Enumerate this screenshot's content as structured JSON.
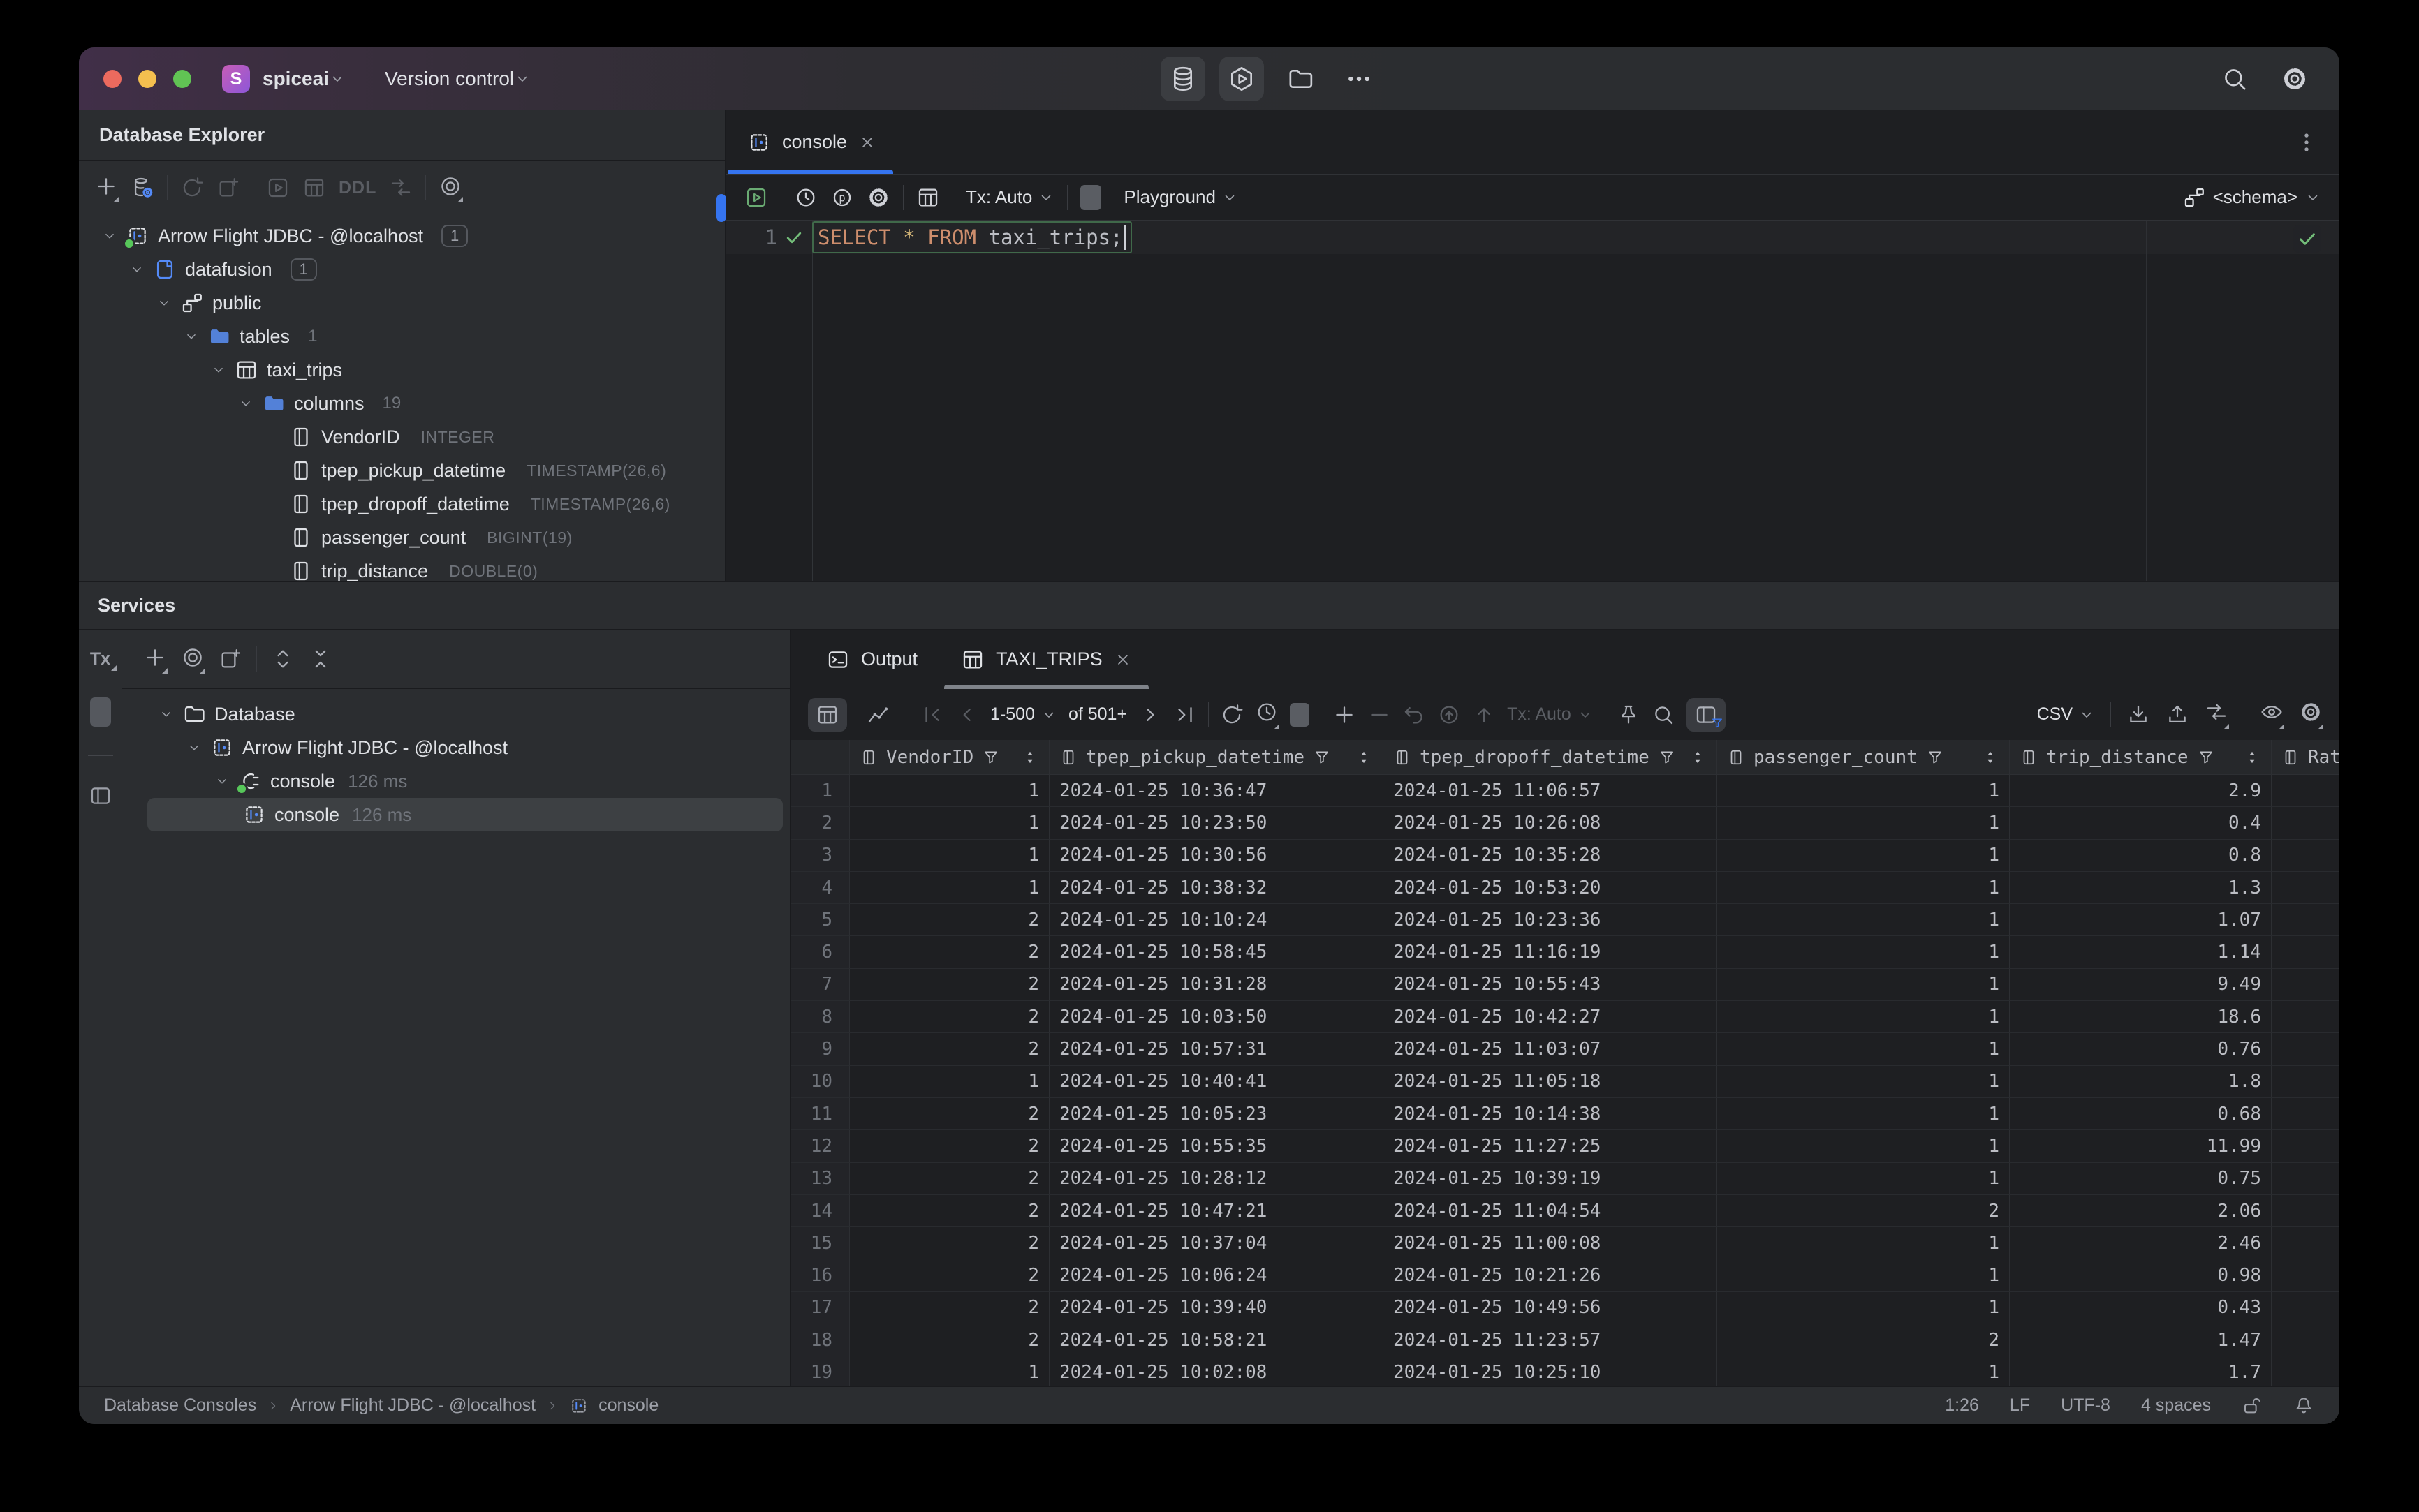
{
  "colors": {
    "accent": "#3574f0",
    "panel_bg": "#2b2d30",
    "editor_bg": "#1e1f22",
    "keyword_orange": "#ce8e6d",
    "run_green": "#6aab73",
    "check_green": "#73bd79",
    "folder_blue": "#548af7"
  },
  "titlebar": {
    "avatar_letter": "S",
    "project": "spiceai",
    "menu": "Version control",
    "center_icons": [
      "database-icon",
      "hexagon-play-icon",
      "folder-icon",
      "more-icon"
    ],
    "right_icons": [
      "search-icon",
      "settings-icon"
    ]
  },
  "explorer": {
    "title": "Database Explorer",
    "toolbar_icons": [
      "add",
      "data-source-properties",
      "refresh",
      "new-console",
      "run",
      "table",
      "DDL",
      "jump-to-ddl",
      "scope-rings"
    ],
    "ddl_label": "DDL",
    "tree": [
      {
        "level": 0,
        "icon": "datasource",
        "label": "Arrow Flight JDBC - @localhost",
        "badge": "1",
        "boxed": true,
        "expanded": true
      },
      {
        "level": 1,
        "icon": "database",
        "label": "datafusion",
        "badge": "1",
        "boxed": true,
        "expanded": true
      },
      {
        "level": 2,
        "icon": "schema",
        "label": "public",
        "expanded": true
      },
      {
        "level": 3,
        "icon": "folder",
        "label": "tables",
        "badge": "1",
        "expanded": true
      },
      {
        "level": 4,
        "icon": "table",
        "label": "taxi_trips",
        "expanded": true
      },
      {
        "level": 5,
        "icon": "folder",
        "label": "columns",
        "badge": "19",
        "expanded": true
      },
      {
        "level": 6,
        "icon": "column",
        "label": "VendorID",
        "type": "INTEGER"
      },
      {
        "level": 6,
        "icon": "column",
        "label": "tpep_pickup_datetime",
        "type": "TIMESTAMP(26,6)"
      },
      {
        "level": 6,
        "icon": "column",
        "label": "tpep_dropoff_datetime",
        "type": "TIMESTAMP(26,6)"
      },
      {
        "level": 6,
        "icon": "column",
        "label": "passenger_count",
        "type": "BIGINT(19)"
      },
      {
        "level": 6,
        "icon": "column",
        "label": "trip_distance",
        "type": "DOUBLE(0)"
      }
    ]
  },
  "editor": {
    "tab": "console",
    "tx": "Tx: Auto",
    "playground": "Playground",
    "schema": "<schema>",
    "line_number": "1",
    "sql": [
      [
        "SELECT",
        "kw"
      ],
      [
        " ",
        "pl"
      ],
      [
        "*",
        "star"
      ],
      [
        " ",
        "pl"
      ],
      [
        "FROM",
        "kw"
      ],
      [
        " ",
        "pl"
      ],
      [
        "taxi_trips",
        "pl"
      ],
      [
        ";",
        "pl"
      ]
    ]
  },
  "services": {
    "title": "Services",
    "strip_tx": "Tx",
    "toolbar_icons": [
      "add",
      "scope-rings",
      "open-in-new",
      "expand-all",
      "collapse-all"
    ],
    "tree": [
      {
        "level": 0,
        "icon": "folderline",
        "label": "Database",
        "expanded": true
      },
      {
        "level": 1,
        "icon": "datasource",
        "label": "Arrow Flight JDBC - @localhost",
        "expanded": true
      },
      {
        "level": 2,
        "icon": "plug",
        "label": "console",
        "meta": "126 ms",
        "expanded": true
      },
      {
        "level": 3,
        "icon": "console",
        "label": "console",
        "meta": "126 ms",
        "selected": true
      }
    ]
  },
  "grid": {
    "tab_output": "Output",
    "tab_result": "TAXI_TRIPS",
    "range": "1-500",
    "of_label": "of 501+",
    "tx": "Tx: Auto",
    "format": "CSV",
    "columns": [
      {
        "label": "VendorID",
        "align": "right",
        "filter": true,
        "sort": true
      },
      {
        "label": "tpep_pickup_datetime",
        "align": "left",
        "filter": true,
        "sort": true
      },
      {
        "label": "tpep_dropoff_datetime",
        "align": "left",
        "filter": true,
        "sort": true
      },
      {
        "label": "passenger_count",
        "align": "right",
        "filter": true,
        "sort": true
      },
      {
        "label": "trip_distance",
        "align": "right",
        "filter": true,
        "sort": true
      },
      {
        "label": "Rate",
        "align": "left",
        "filter": false,
        "sort": false
      }
    ],
    "rows": [
      [
        "1",
        "1",
        "2024-01-25 10:36:47",
        "2024-01-25 11:06:57",
        "1",
        "2.9"
      ],
      [
        "2",
        "1",
        "2024-01-25 10:23:50",
        "2024-01-25 10:26:08",
        "1",
        "0.4"
      ],
      [
        "3",
        "1",
        "2024-01-25 10:30:56",
        "2024-01-25 10:35:28",
        "1",
        "0.8"
      ],
      [
        "4",
        "1",
        "2024-01-25 10:38:32",
        "2024-01-25 10:53:20",
        "1",
        "1.3"
      ],
      [
        "5",
        "2",
        "2024-01-25 10:10:24",
        "2024-01-25 10:23:36",
        "1",
        "1.07"
      ],
      [
        "6",
        "2",
        "2024-01-25 10:58:45",
        "2024-01-25 11:16:19",
        "1",
        "1.14"
      ],
      [
        "7",
        "2",
        "2024-01-25 10:31:28",
        "2024-01-25 10:55:43",
        "1",
        "9.49"
      ],
      [
        "8",
        "2",
        "2024-01-25 10:03:50",
        "2024-01-25 10:42:27",
        "1",
        "18.6"
      ],
      [
        "9",
        "2",
        "2024-01-25 10:57:31",
        "2024-01-25 11:03:07",
        "1",
        "0.76"
      ],
      [
        "10",
        "1",
        "2024-01-25 10:40:41",
        "2024-01-25 11:05:18",
        "1",
        "1.8"
      ],
      [
        "11",
        "2",
        "2024-01-25 10:05:23",
        "2024-01-25 10:14:38",
        "1",
        "0.68"
      ],
      [
        "12",
        "2",
        "2024-01-25 10:55:35",
        "2024-01-25 11:27:25",
        "1",
        "11.99"
      ],
      [
        "13",
        "2",
        "2024-01-25 10:28:12",
        "2024-01-25 10:39:19",
        "1",
        "0.75"
      ],
      [
        "14",
        "2",
        "2024-01-25 10:47:21",
        "2024-01-25 11:04:54",
        "2",
        "2.06"
      ],
      [
        "15",
        "2",
        "2024-01-25 10:37:04",
        "2024-01-25 11:00:08",
        "1",
        "2.46"
      ],
      [
        "16",
        "2",
        "2024-01-25 10:06:24",
        "2024-01-25 10:21:26",
        "1",
        "0.98"
      ],
      [
        "17",
        "2",
        "2024-01-25 10:39:40",
        "2024-01-25 10:49:56",
        "1",
        "0.43"
      ],
      [
        "18",
        "2",
        "2024-01-25 10:58:21",
        "2024-01-25 11:23:57",
        "2",
        "1.47"
      ],
      [
        "19",
        "1",
        "2024-01-25 10:02:08",
        "2024-01-25 10:25:10",
        "1",
        "1.7"
      ]
    ]
  },
  "status": {
    "breadcrumbs": [
      "Database Consoles",
      "Arrow Flight JDBC - @localhost",
      "console"
    ],
    "caret": "1:26",
    "line_ending": "LF",
    "encoding": "UTF-8",
    "indent": "4 spaces"
  }
}
